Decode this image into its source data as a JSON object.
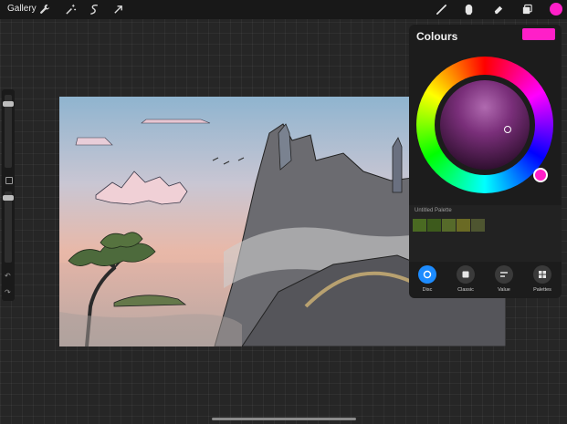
{
  "topbar": {
    "gallery_label": "Gallery",
    "left_tools": [
      "wrench-icon",
      "magic-wand-icon",
      "selection-icon",
      "transform-arrow-icon"
    ],
    "right_tools": [
      "brush-icon",
      "smudge-icon",
      "eraser-icon",
      "layers-icon"
    ]
  },
  "colours_panel": {
    "title": "Colours",
    "current_colour": "#ff1fc8",
    "palette_title": "Untitled Palette",
    "palette_swatches": [
      "#4a6a22",
      "#3d5a1c",
      "#566a2a",
      "#6a6a24",
      "#4e5530"
    ],
    "tabs": [
      {
        "label": "Disc",
        "icon": "disc-icon",
        "active": true
      },
      {
        "label": "Classic",
        "icon": "classic-icon",
        "active": false
      },
      {
        "label": "Value",
        "icon": "value-icon",
        "active": false
      },
      {
        "label": "Palettes",
        "icon": "palettes-icon",
        "active": false
      }
    ]
  },
  "sidebar": {
    "brush_size_level": 0.07,
    "brush_opacity_level": 0.52
  },
  "colors": {
    "accent": "#ff1fc8",
    "active_tab": "#1d8cff"
  }
}
